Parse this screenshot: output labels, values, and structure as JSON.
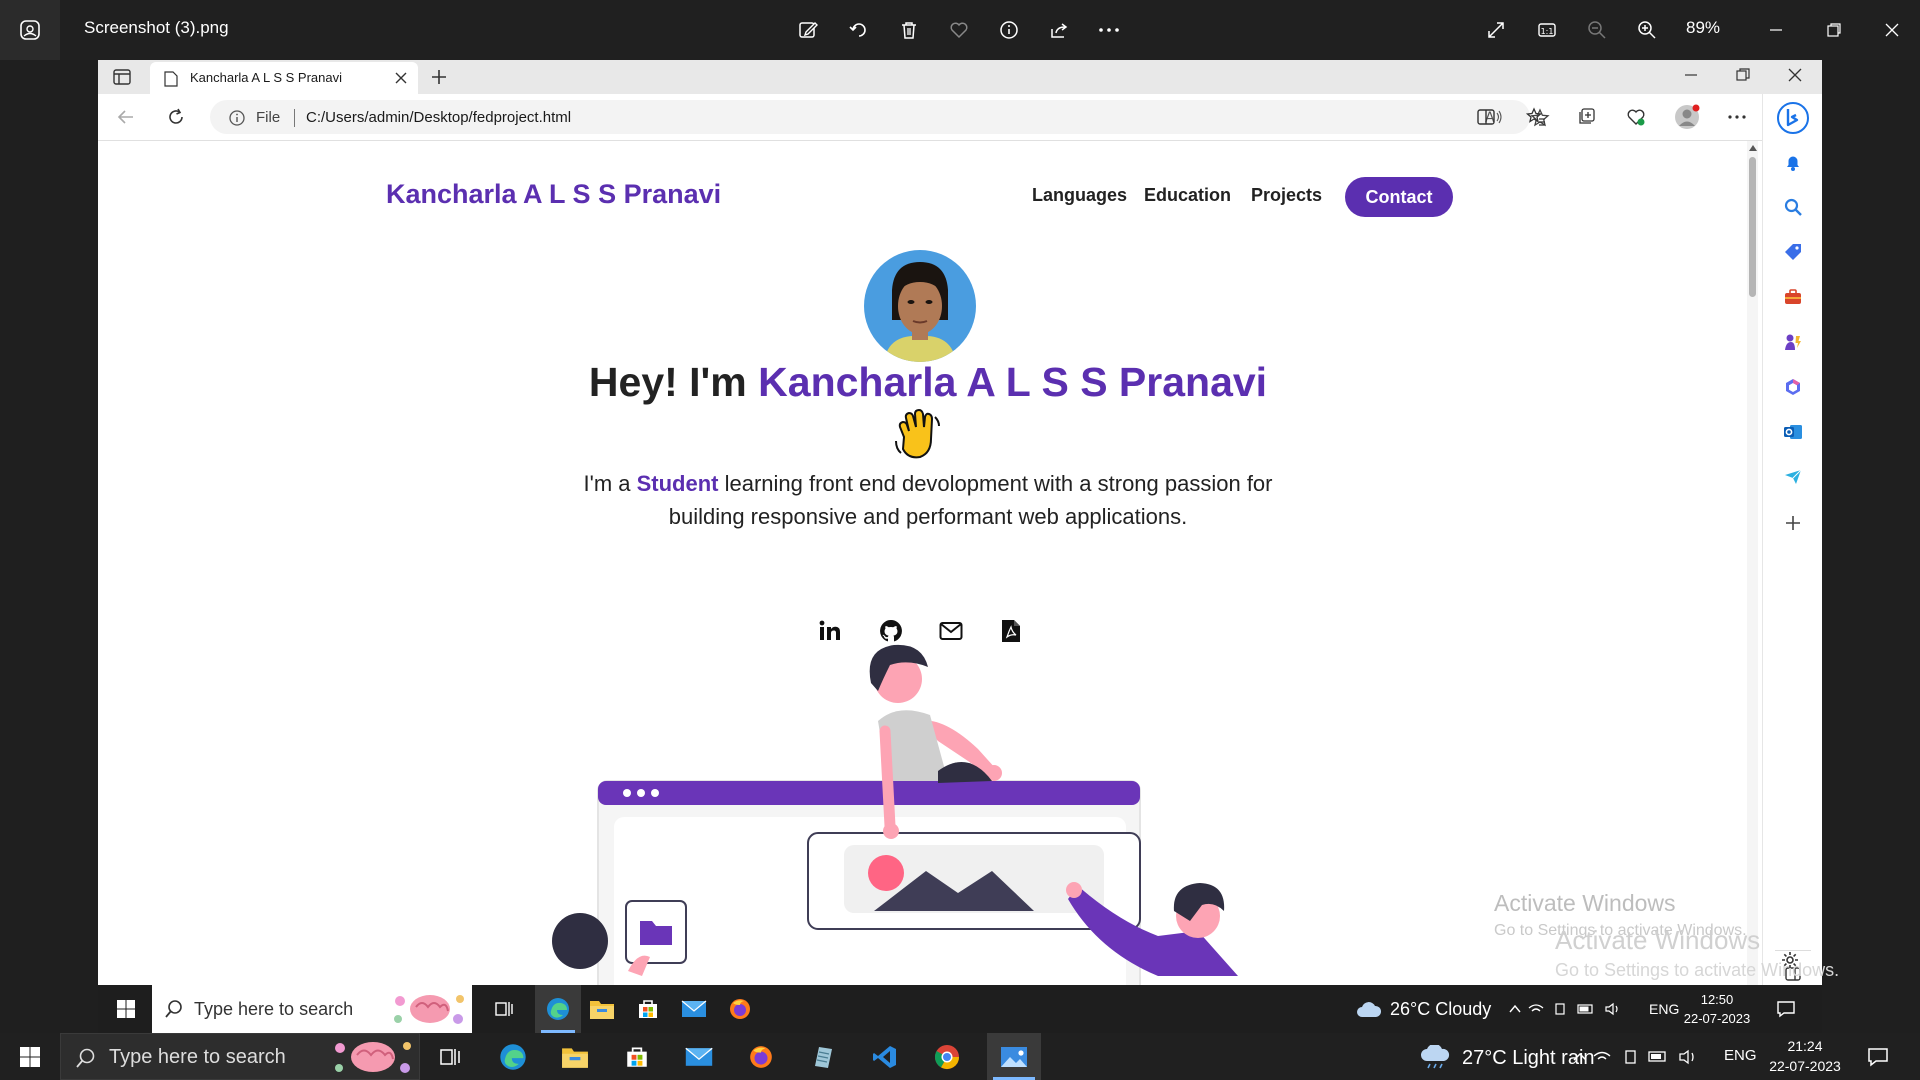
{
  "viewer": {
    "title": "Screenshot (3).png",
    "zoom": "89%",
    "tools": [
      "edit-icon",
      "rotate-icon",
      "delete-icon",
      "favorite-icon",
      "info-icon",
      "share-icon",
      "more-icon"
    ],
    "right_tools": [
      "fullscreen-icon",
      "actual-size-icon",
      "zoom-out-icon",
      "zoom-in-icon"
    ]
  },
  "browser": {
    "tab_title": "Kancharla A L S S Pranavi",
    "address_prefix": "File",
    "url": "C:/Users/admin/Desktop/fedproject.html"
  },
  "page": {
    "brand": "Kancharla A L S S Pranavi",
    "nav": [
      "Languages",
      "Education",
      "Projects"
    ],
    "contact_label": "Contact",
    "headline_prefix": "Hey! I'm ",
    "headline_name": "Kancharla A L S S Pranavi",
    "wave_emoji": "👋",
    "intro_prefix": "I'm a ",
    "intro_role": "Student",
    "intro_rest": " learning front end devolopment with a strong passion for building responsive and performant web applications.",
    "socials": [
      "linkedin-icon",
      "github-icon",
      "email-icon",
      "pdf-resume-icon"
    ],
    "accent_color": "#5b2fb0"
  },
  "watermark": {
    "title": "Activate Windows",
    "subtitle": "Go to Settings to activate Windows."
  },
  "inner_taskbar": {
    "search_placeholder": "Type here to search",
    "weather": "26°C  Cloudy",
    "lang": "ENG",
    "time": "12:50",
    "date": "22-07-2023"
  },
  "outer_taskbar": {
    "search_placeholder": "Type here to search",
    "weather": "27°C  Light rain",
    "lang": "ENG",
    "time": "21:24",
    "date": "22-07-2023"
  }
}
